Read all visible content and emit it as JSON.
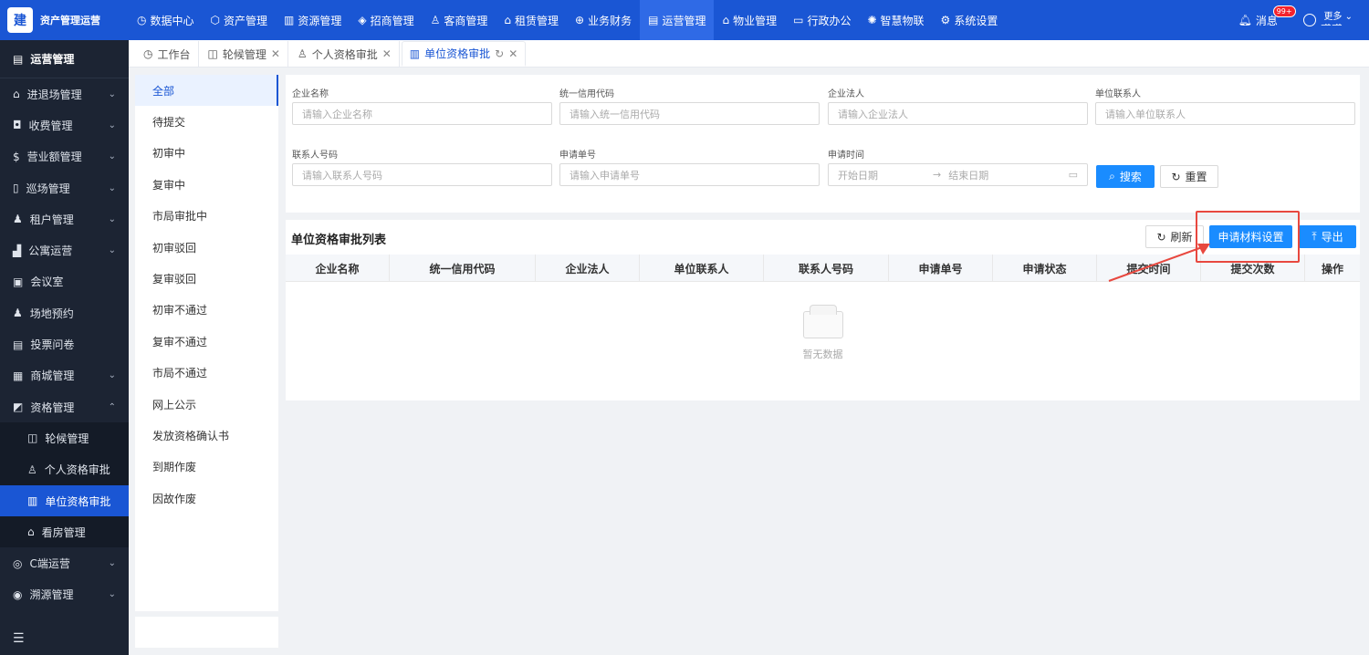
{
  "app": {
    "brand_icon": "建",
    "brand_name": "资产管理运营",
    "colors": {
      "primary": "#1a56d4",
      "sidebar": "#1c2433",
      "annotation": "#e8483f"
    }
  },
  "topnav": [
    {
      "icon": "dashboard-icon",
      "glyph": "◷",
      "label": "数据中心"
    },
    {
      "icon": "cube-icon",
      "glyph": "⬡",
      "label": "资产管理"
    },
    {
      "icon": "building-icon",
      "glyph": "▥",
      "label": "资源管理"
    },
    {
      "icon": "tag-icon",
      "glyph": "◈",
      "label": "招商管理"
    },
    {
      "icon": "customer-icon",
      "glyph": "♙",
      "label": "客商管理"
    },
    {
      "icon": "house-icon",
      "glyph": "⌂",
      "label": "租赁管理"
    },
    {
      "icon": "money-icon",
      "glyph": "⊕",
      "label": "业务财务"
    },
    {
      "icon": "operation-icon",
      "glyph": "▤",
      "label": "运营管理"
    },
    {
      "icon": "home-service-icon",
      "glyph": "⌂",
      "label": "物业管理"
    },
    {
      "icon": "monitor-icon",
      "glyph": "▭",
      "label": "行政办公"
    },
    {
      "icon": "iot-icon",
      "glyph": "✺",
      "label": "智慧物联"
    },
    {
      "icon": "settings-icon",
      "glyph": "⚙",
      "label": "系统设置"
    }
  ],
  "topright": {
    "message_label": "消息",
    "message_badge": "99+",
    "user_name": "莹莹"
  },
  "sidebar": {
    "title": "运营管理",
    "items": [
      {
        "icon": "gate-icon",
        "glyph": "⌂",
        "label": "进退场管理",
        "has_arrow": true
      },
      {
        "icon": "cash-icon",
        "glyph": "◘",
        "label": "收费管理",
        "has_arrow": true
      },
      {
        "icon": "revenue-icon",
        "glyph": "$",
        "label": "营业额管理",
        "has_arrow": true
      },
      {
        "icon": "map-icon",
        "glyph": "▯",
        "label": "巡场管理",
        "has_arrow": true
      },
      {
        "icon": "tenant-icon",
        "glyph": "♟",
        "label": "租户管理",
        "has_arrow": true
      },
      {
        "icon": "apartment-icon",
        "glyph": "▟",
        "label": "公寓运营",
        "has_arrow": true
      },
      {
        "icon": "meeting-icon",
        "glyph": "▣",
        "label": "会议室",
        "has_arrow": false
      },
      {
        "icon": "venue-icon",
        "glyph": "♟",
        "label": "场地预约",
        "has_arrow": false
      },
      {
        "icon": "vote-icon",
        "glyph": "▤",
        "label": "投票问卷",
        "has_arrow": false
      },
      {
        "icon": "mall-icon",
        "glyph": "▦",
        "label": "商城管理",
        "has_arrow": true
      },
      {
        "icon": "qualification-icon",
        "glyph": "◩",
        "label": "资格管理",
        "has_arrow": true,
        "expanded": true
      }
    ],
    "sub_items": [
      {
        "icon": "queue-icon",
        "glyph": "◫",
        "label": "轮候管理"
      },
      {
        "icon": "person-icon",
        "glyph": "♙",
        "label": "个人资格审批"
      },
      {
        "icon": "company-icon",
        "glyph": "▥",
        "label": "单位资格审批",
        "active": true
      },
      {
        "icon": "house-view-icon",
        "glyph": "⌂",
        "label": "看房管理"
      }
    ],
    "bottom_items": [
      {
        "icon": "c-end-icon",
        "glyph": "◎",
        "label": "C端运营",
        "has_arrow": true
      },
      {
        "icon": "trace-icon",
        "glyph": "◉",
        "label": "溯源管理",
        "has_arrow": true
      }
    ]
  },
  "tabs": [
    {
      "icon": "dashboard-icon",
      "glyph": "◷",
      "label": "工作台",
      "closable": false
    },
    {
      "icon": "queue-icon",
      "glyph": "◫",
      "label": "轮候管理",
      "closable": true
    },
    {
      "icon": "person-icon",
      "glyph": "♙",
      "label": "个人资格审批",
      "closable": true
    },
    {
      "icon": "company-icon",
      "glyph": "▥",
      "label": "单位资格审批",
      "closable": true,
      "active": true
    }
  ],
  "more_label": "更多",
  "status_list": [
    "全部",
    "待提交",
    "初审中",
    "复审中",
    "市局审批中",
    "初审驳回",
    "复审驳回",
    "初审不通过",
    "复审不通过",
    "市局不通过",
    "网上公示",
    "发放资格确认书",
    "到期作废",
    "因故作废"
  ],
  "filters": {
    "company_name": {
      "label": "企业名称",
      "placeholder": "请输入企业名称"
    },
    "credit_code": {
      "label": "统一信用代码",
      "placeholder": "请输入统一信用代码"
    },
    "legal_person": {
      "label": "企业法人",
      "placeholder": "请输入企业法人"
    },
    "contact": {
      "label": "单位联系人",
      "placeholder": "请输入单位联系人"
    },
    "contact_phone": {
      "label": "联系人号码",
      "placeholder": "请输入联系人号码"
    },
    "apply_no": {
      "label": "申请单号",
      "placeholder": "请输入申请单号"
    },
    "apply_time": {
      "label": "申请时间",
      "start": "开始日期",
      "sep": "→",
      "end": "结束日期"
    },
    "search_label": "搜索",
    "reset_label": "重置"
  },
  "list": {
    "title": "单位资格审批列表",
    "refresh_label": "刷新",
    "material_label": "申请材料设置",
    "export_label": "导出",
    "columns": [
      "企业名称",
      "统一信用代码",
      "企业法人",
      "单位联系人",
      "联系人号码",
      "申请单号",
      "申请状态",
      "提交时间",
      "提交次数",
      "操作"
    ],
    "empty_text": "暂无数据"
  }
}
